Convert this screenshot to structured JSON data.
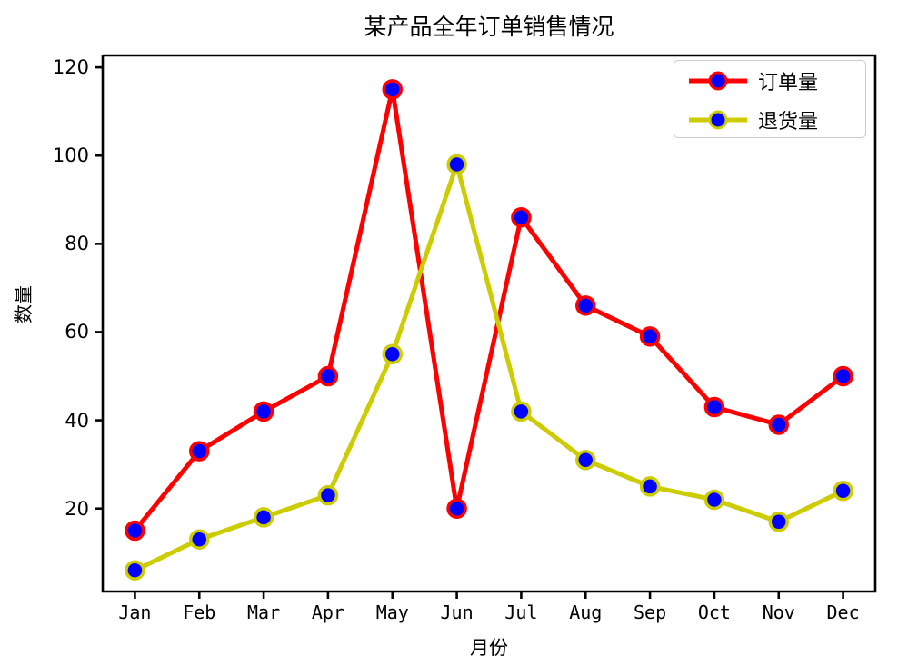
{
  "chart_data": {
    "type": "line",
    "title": "某产品全年订单销售情况",
    "xlabel": "月份",
    "ylabel": "数量",
    "categories": [
      "Jan",
      "Feb",
      "Mar",
      "Apr",
      "May",
      "Jun",
      "Jul",
      "Aug",
      "Sep",
      "Oct",
      "Nov",
      "Dec"
    ],
    "series": [
      {
        "name": "订单量",
        "values": [
          15,
          33,
          42,
          50,
          115,
          20,
          86,
          66,
          59,
          43,
          39,
          50
        ],
        "line_color": "#ff0000",
        "marker_face_color": "#0000ff",
        "marker_edge_color": "#ff0000"
      },
      {
        "name": "退货量",
        "values": [
          6,
          13,
          18,
          23,
          55,
          98,
          42,
          31,
          25,
          22,
          17,
          24
        ],
        "line_color": "#cccc00",
        "marker_face_color": "#0000ff",
        "marker_edge_color": "#cccc00"
      }
    ],
    "yticks": [
      20,
      40,
      60,
      80,
      100,
      120
    ],
    "ylim": [
      1.2,
      122.7
    ],
    "xlim": [
      -0.5,
      11.5
    ],
    "grid": false,
    "legend_position": "upper right",
    "axes_color": "#000000",
    "background_color": "#ffffff"
  }
}
